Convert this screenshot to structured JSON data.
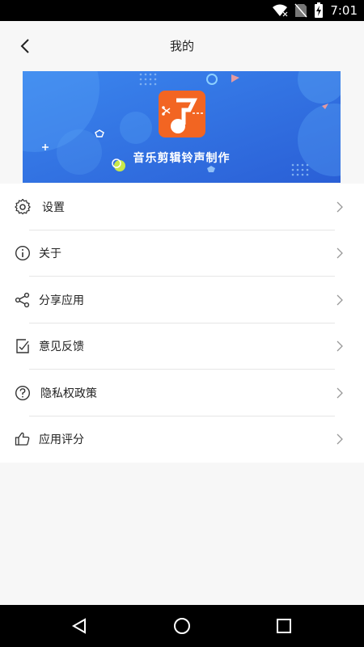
{
  "status": {
    "time": "7:01"
  },
  "header": {
    "title": "我的"
  },
  "banner": {
    "app_name": "音乐剪辑铃声制作"
  },
  "menu": {
    "items": [
      {
        "label": "设置",
        "icon": "gear-icon"
      },
      {
        "label": "关于",
        "icon": "info-icon"
      },
      {
        "label": "分享应用",
        "icon": "share-icon"
      },
      {
        "label": "意见反馈",
        "icon": "feedback-icon"
      },
      {
        "label": "隐私权政策",
        "icon": "question-icon"
      },
      {
        "label": "应用评分",
        "icon": "thumbs-up-icon"
      }
    ]
  },
  "colors": {
    "banner_blue": "#2f6fe0",
    "logo_orange": "#f26522"
  }
}
